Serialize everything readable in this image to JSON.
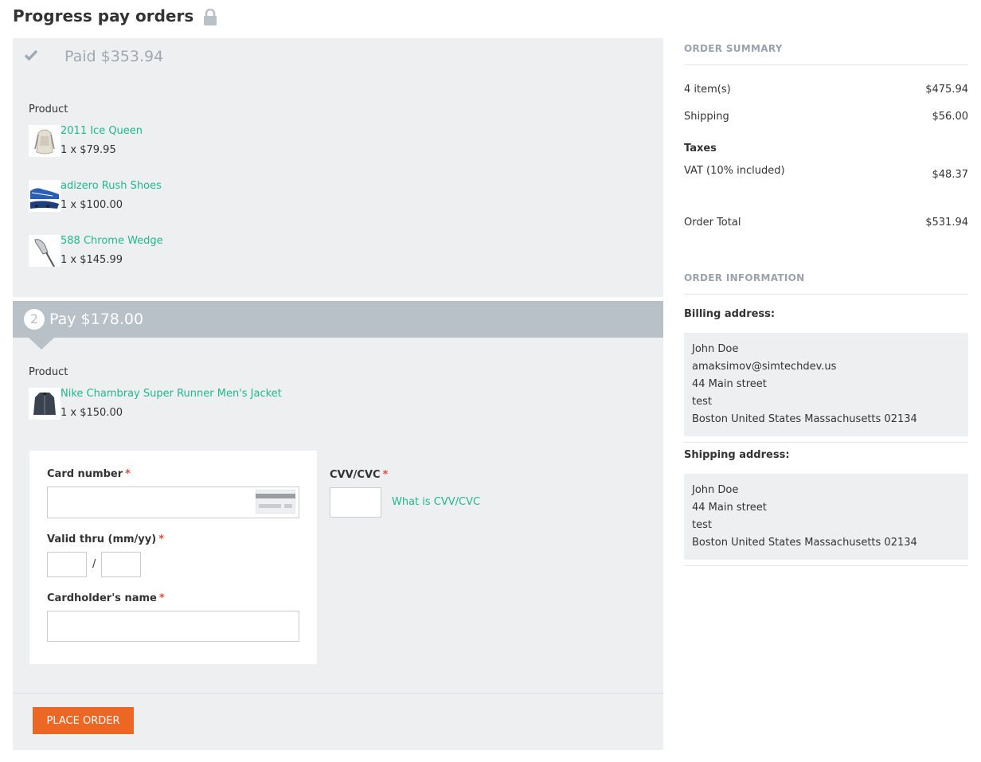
{
  "page": {
    "title": "Progress pay orders"
  },
  "paid_order": {
    "status_text": "Paid $353.94",
    "product_label": "Product",
    "products": [
      {
        "name": "2011 Ice Queen",
        "qty": "1 x $79.95"
      },
      {
        "name": "adizero Rush Shoes",
        "qty": "1 x $100.00"
      },
      {
        "name": "588 Chrome Wedge",
        "qty": "1 x $145.99"
      }
    ]
  },
  "pay_order": {
    "step_number": "2",
    "pay_text": "Pay $178.00",
    "product_label": "Product",
    "products": [
      {
        "name": "Nike Chambray Super Runner Men's Jacket",
        "qty": "1 x $150.00"
      }
    ]
  },
  "card_form": {
    "card_number_label": "Card number",
    "valid_thru_label": "Valid thru (mm/yy)",
    "slash": "/",
    "cardholder_label": "Cardholder's name",
    "cvv_label": "CVV/CVC",
    "cvv_link": "What is CVV/CVC",
    "required_mark": "*",
    "card_number_value": "",
    "month_value": "",
    "year_value": "",
    "cardholder_value": "",
    "cvv_value": ""
  },
  "actions": {
    "place_order": "PLACE ORDER"
  },
  "summary": {
    "heading": "ORDER SUMMARY",
    "items_label": "4 item(s)",
    "items_value": "$475.94",
    "shipping_label": "Shipping",
    "shipping_value": "$56.00",
    "taxes_label": "Taxes",
    "vat_label": "VAT (10% included)",
    "vat_value": "$48.37",
    "total_label": "Order Total",
    "total_value": "$531.94"
  },
  "info": {
    "heading": "ORDER INFORMATION",
    "billing_title": "Billing address:",
    "billing_lines": [
      "John Doe",
      "amaksimov@simtechdev.us",
      "44 Main street",
      "test",
      "Boston United States Massachusetts 02134"
    ],
    "shipping_title": "Shipping address:",
    "shipping_lines": [
      "John Doe",
      "44 Main street",
      "test",
      "Boston United States Massachusetts 02134"
    ]
  },
  "colors": {
    "accent_green": "#1fb88c",
    "button_orange": "#ec6624",
    "panel_gray": "#eeeff1",
    "step_header": "#b8c0c8",
    "required_red": "#e04e3b"
  },
  "icons": {
    "lock": "lock-icon",
    "check": "check-icon",
    "card": "credit-card-icon"
  }
}
